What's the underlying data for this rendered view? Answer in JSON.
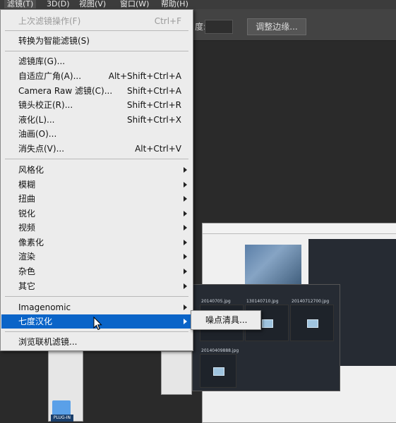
{
  "menubar": {
    "items": [
      "滤镜(T)",
      "3D(D)",
      "视图(V)",
      "窗口(W)",
      "帮助(H)"
    ],
    "active_index": 0
  },
  "options_bar": {
    "label": "度:",
    "refine_edge_button": "调整边缘..."
  },
  "filter_menu": {
    "items": [
      {
        "label": "上次滤镜操作(F)",
        "shortcut": "Ctrl+F",
        "disabled": true
      },
      {
        "label": "转换为智能滤镜(S)"
      },
      {
        "label": "滤镜库(G)..."
      },
      {
        "label": "自适应广角(A)...",
        "shortcut": "Alt+Shift+Ctrl+A"
      },
      {
        "label": "Camera Raw 滤镜(C)...",
        "shortcut": "Shift+Ctrl+A"
      },
      {
        "label": "镜头校正(R)...",
        "shortcut": "Shift+Ctrl+R"
      },
      {
        "label": "液化(L)...",
        "shortcut": "Shift+Ctrl+X"
      },
      {
        "label": "油画(O)..."
      },
      {
        "label": "消失点(V)...",
        "shortcut": "Alt+Ctrl+V"
      },
      {
        "label": "风格化",
        "submenu": true
      },
      {
        "label": "模糊",
        "submenu": true
      },
      {
        "label": "扭曲",
        "submenu": true
      },
      {
        "label": "锐化",
        "submenu": true
      },
      {
        "label": "视频",
        "submenu": true
      },
      {
        "label": "像素化",
        "submenu": true
      },
      {
        "label": "渲染",
        "submenu": true
      },
      {
        "label": "杂色",
        "submenu": true
      },
      {
        "label": "其它",
        "submenu": true
      },
      {
        "label": "Imagenomic",
        "submenu": true
      },
      {
        "label": "七度汉化",
        "submenu": true,
        "highlighted": true
      },
      {
        "label": "浏览联机滤镜..."
      }
    ]
  },
  "submenu": {
    "items": [
      "噪点清具..."
    ]
  },
  "background": {
    "thumb_labels": [
      "20140705.jpg",
      "130140710.jpg",
      "20140712700.jpg",
      "20140409888.jpg"
    ],
    "plugin_label": "PLUG-IN"
  },
  "colors": {
    "highlight": "#0a64c8",
    "menu_bg": "#ececec",
    "workspace": "#2a2a2a"
  }
}
